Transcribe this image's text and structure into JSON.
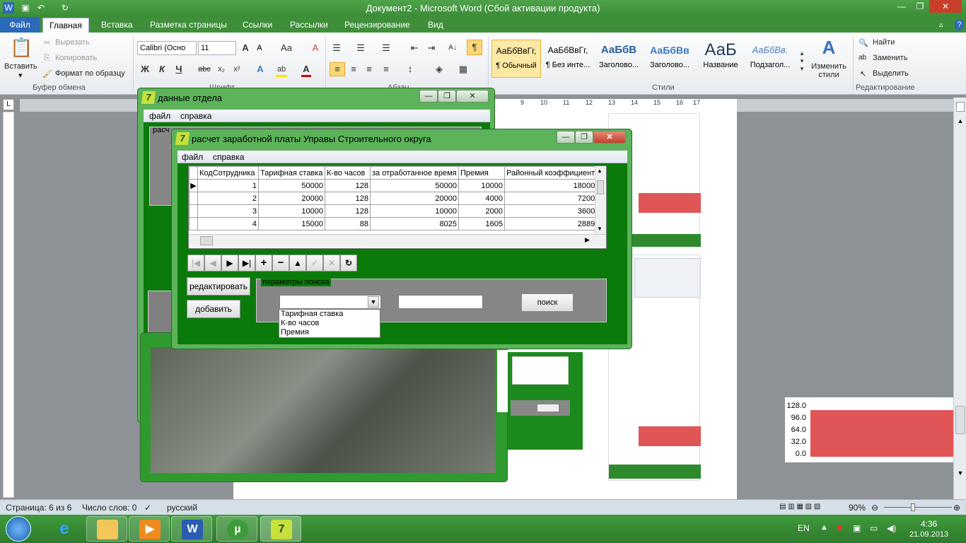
{
  "word": {
    "title": "Документ2 - Microsoft Word (Сбой активации продукта)",
    "tabs": [
      "Файл",
      "Главная",
      "Вставка",
      "Разметка страницы",
      "Ссылки",
      "Рассылки",
      "Рецензирование",
      "Вид"
    ],
    "clipboard": {
      "paste": "Вставить",
      "cut": "Вырезать",
      "copy": "Копировать",
      "format_painter": "Формат по образцу",
      "group": "Буфер обмена"
    },
    "font": {
      "name": "Calibri (Осно",
      "size": "11",
      "group": "Шрифт"
    },
    "paragraph_group": "Абзац",
    "styles": {
      "items": [
        {
          "sample": "АаБбВвГг,",
          "label": "¶ Обычный"
        },
        {
          "sample": "АаБбВвГг,",
          "label": "¶ Без инте..."
        },
        {
          "sample": "АаБбВ",
          "label": "Заголово..."
        },
        {
          "sample": "АаБбВв",
          "label": "Заголово..."
        },
        {
          "sample": "АаБ",
          "label": "Название"
        },
        {
          "sample": "АаБбВв.",
          "label": "Подзагол..."
        }
      ],
      "change": "Изменить стили",
      "group": "Стили"
    },
    "editing": {
      "find": "Найти",
      "replace": "Заменить",
      "select": "Выделить",
      "group": "Редактирование"
    },
    "ruler_marks": [
      "9",
      "10",
      "11",
      "12",
      "13",
      "14",
      "15",
      "16",
      "17"
    ],
    "status": {
      "page": "Страница: 6 из 6",
      "words": "Число слов: 0",
      "lang": "русский",
      "zoom": "90%"
    },
    "thumb_chart_labels": [
      "128.0",
      "96.0",
      "64.0",
      "32.0",
      "0.0"
    ]
  },
  "taskbar": {
    "lang": "EN",
    "time": "4:36",
    "date": "21.09.2013"
  },
  "dept_window": {
    "title": "данные отдела",
    "menu": [
      "файл",
      "справка"
    ],
    "group_caption": "расч"
  },
  "salary_window": {
    "title": "расчет заработной платы Управы Строительного округа",
    "menu": [
      "файл",
      "справка"
    ],
    "grid": {
      "columns": [
        "КодСотрудника",
        "Тарифная ставка",
        "К-во часов",
        "за отработанное время",
        "Премия",
        "Районный коэффициент"
      ],
      "rows": [
        [
          "1",
          "50000",
          "128",
          "50000",
          "10000",
          "18000"
        ],
        [
          "2",
          "20000",
          "128",
          "20000",
          "4000",
          "7200"
        ],
        [
          "3",
          "10000",
          "128",
          "10000",
          "2000",
          "3600"
        ],
        [
          "4",
          "15000",
          "88",
          "8025",
          "1605",
          "2889"
        ]
      ]
    },
    "edit_button": "редактировать",
    "add_button": "добавить",
    "search": {
      "caption": "параметры поиска",
      "combo_value": "",
      "text_value": "",
      "options": [
        "Тарифная ставка",
        "К-во часов",
        "Премия"
      ],
      "button": "поиск"
    }
  }
}
